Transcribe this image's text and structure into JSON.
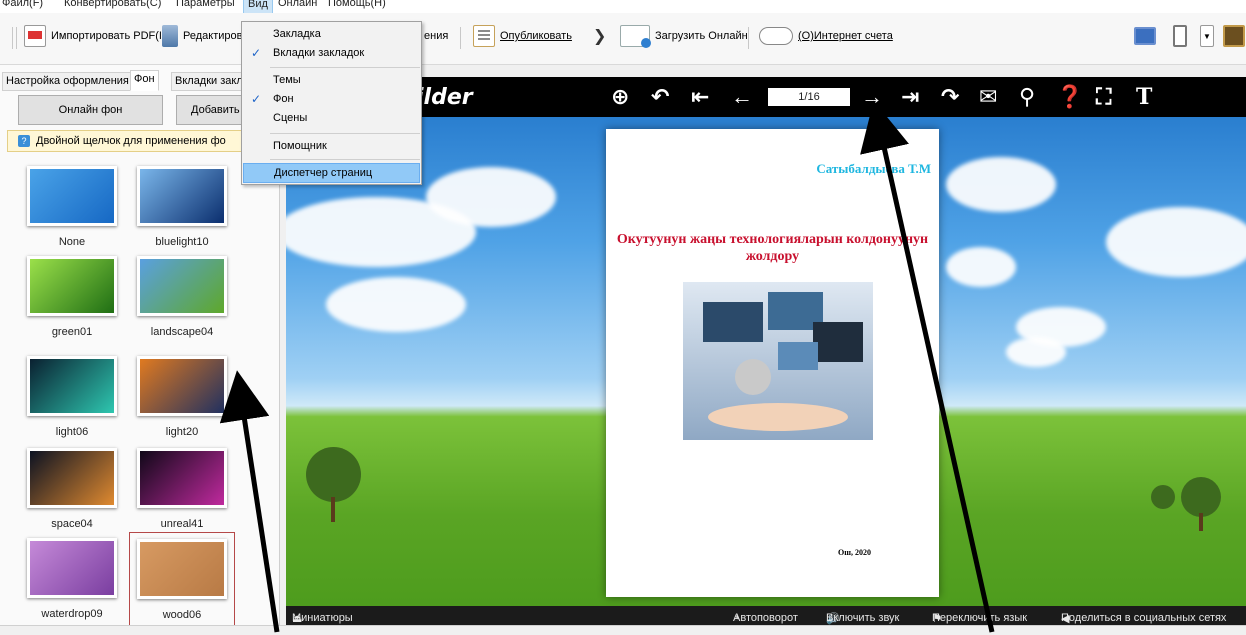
{
  "menubar": {
    "items": [
      {
        "label": "Файл(F)"
      },
      {
        "label": "Конвертировать(C)"
      },
      {
        "label": "Параметры"
      },
      {
        "label": "Вид"
      },
      {
        "label": "Онлайн"
      },
      {
        "label": "Помощь(H)"
      }
    ]
  },
  "toolbar": {
    "import_pdf": "Импортировать PDF(I)",
    "edit": "Редактирова",
    "edit_tail": "ения",
    "publish": "Опубликовать",
    "upload_online": "Загрузить Онлайн",
    "internet_account": "(O)Интернет счета"
  },
  "view_menu": {
    "items": [
      {
        "label": "Закладка",
        "checked": false
      },
      {
        "label": "Вкладки закладок",
        "checked": true
      },
      {
        "label": "Темы",
        "checked": false
      },
      {
        "label": "Фон",
        "checked": true
      },
      {
        "label": "Сцены",
        "checked": false
      },
      {
        "label": "Помощник",
        "checked": false
      },
      {
        "label": "Диспетчер страниц",
        "checked": false
      }
    ]
  },
  "left_panel": {
    "tabs": [
      "Настройка оформления",
      "Фон",
      "Вкладки закла"
    ],
    "online_bg_button": "Онлайн фон",
    "add_button": "Добавить ф",
    "hint": "Двойной щелчок для применения фо",
    "thumbnails": [
      {
        "label": "None",
        "colors": [
          "#4aa3e8",
          "#1668c4"
        ]
      },
      {
        "label": "bluelight10",
        "colors": [
          "#7ab6ea",
          "#0b2e6e"
        ]
      },
      {
        "label": "green01",
        "colors": [
          "#9be04a",
          "#1f6e14"
        ]
      },
      {
        "label": "landscape04",
        "colors": [
          "#5aa0e0",
          "#5ea82a"
        ]
      },
      {
        "label": "light06",
        "colors": [
          "#0a2030",
          "#2ec7b0"
        ]
      },
      {
        "label": "light20",
        "colors": [
          "#e07a20",
          "#203060"
        ]
      },
      {
        "label": "space04",
        "colors": [
          "#0c1222",
          "#e08a30"
        ]
      },
      {
        "label": "unreal41",
        "colors": [
          "#100818",
          "#c02a9e"
        ]
      },
      {
        "label": "waterdrop09",
        "colors": [
          "#c58ad8",
          "#7a3ea0"
        ]
      },
      {
        "label": "wood06",
        "colors": [
          "#d79a62",
          "#b87a45"
        ]
      }
    ]
  },
  "stage": {
    "brand": "ilder",
    "page_indicator": "1/16",
    "book": {
      "author": "Сатыбалдыева Т.М",
      "title": "Окутуунун жаңы технологияларын колдонуунун жолдору",
      "footer": "Ош, 2020"
    }
  },
  "bottombar": {
    "thumbnails": "Миниатюры",
    "autoflip": "Автоповорот",
    "sound": "Включить звук",
    "language": "Переключить язык",
    "share": "Поделиться в социальных сетях"
  }
}
